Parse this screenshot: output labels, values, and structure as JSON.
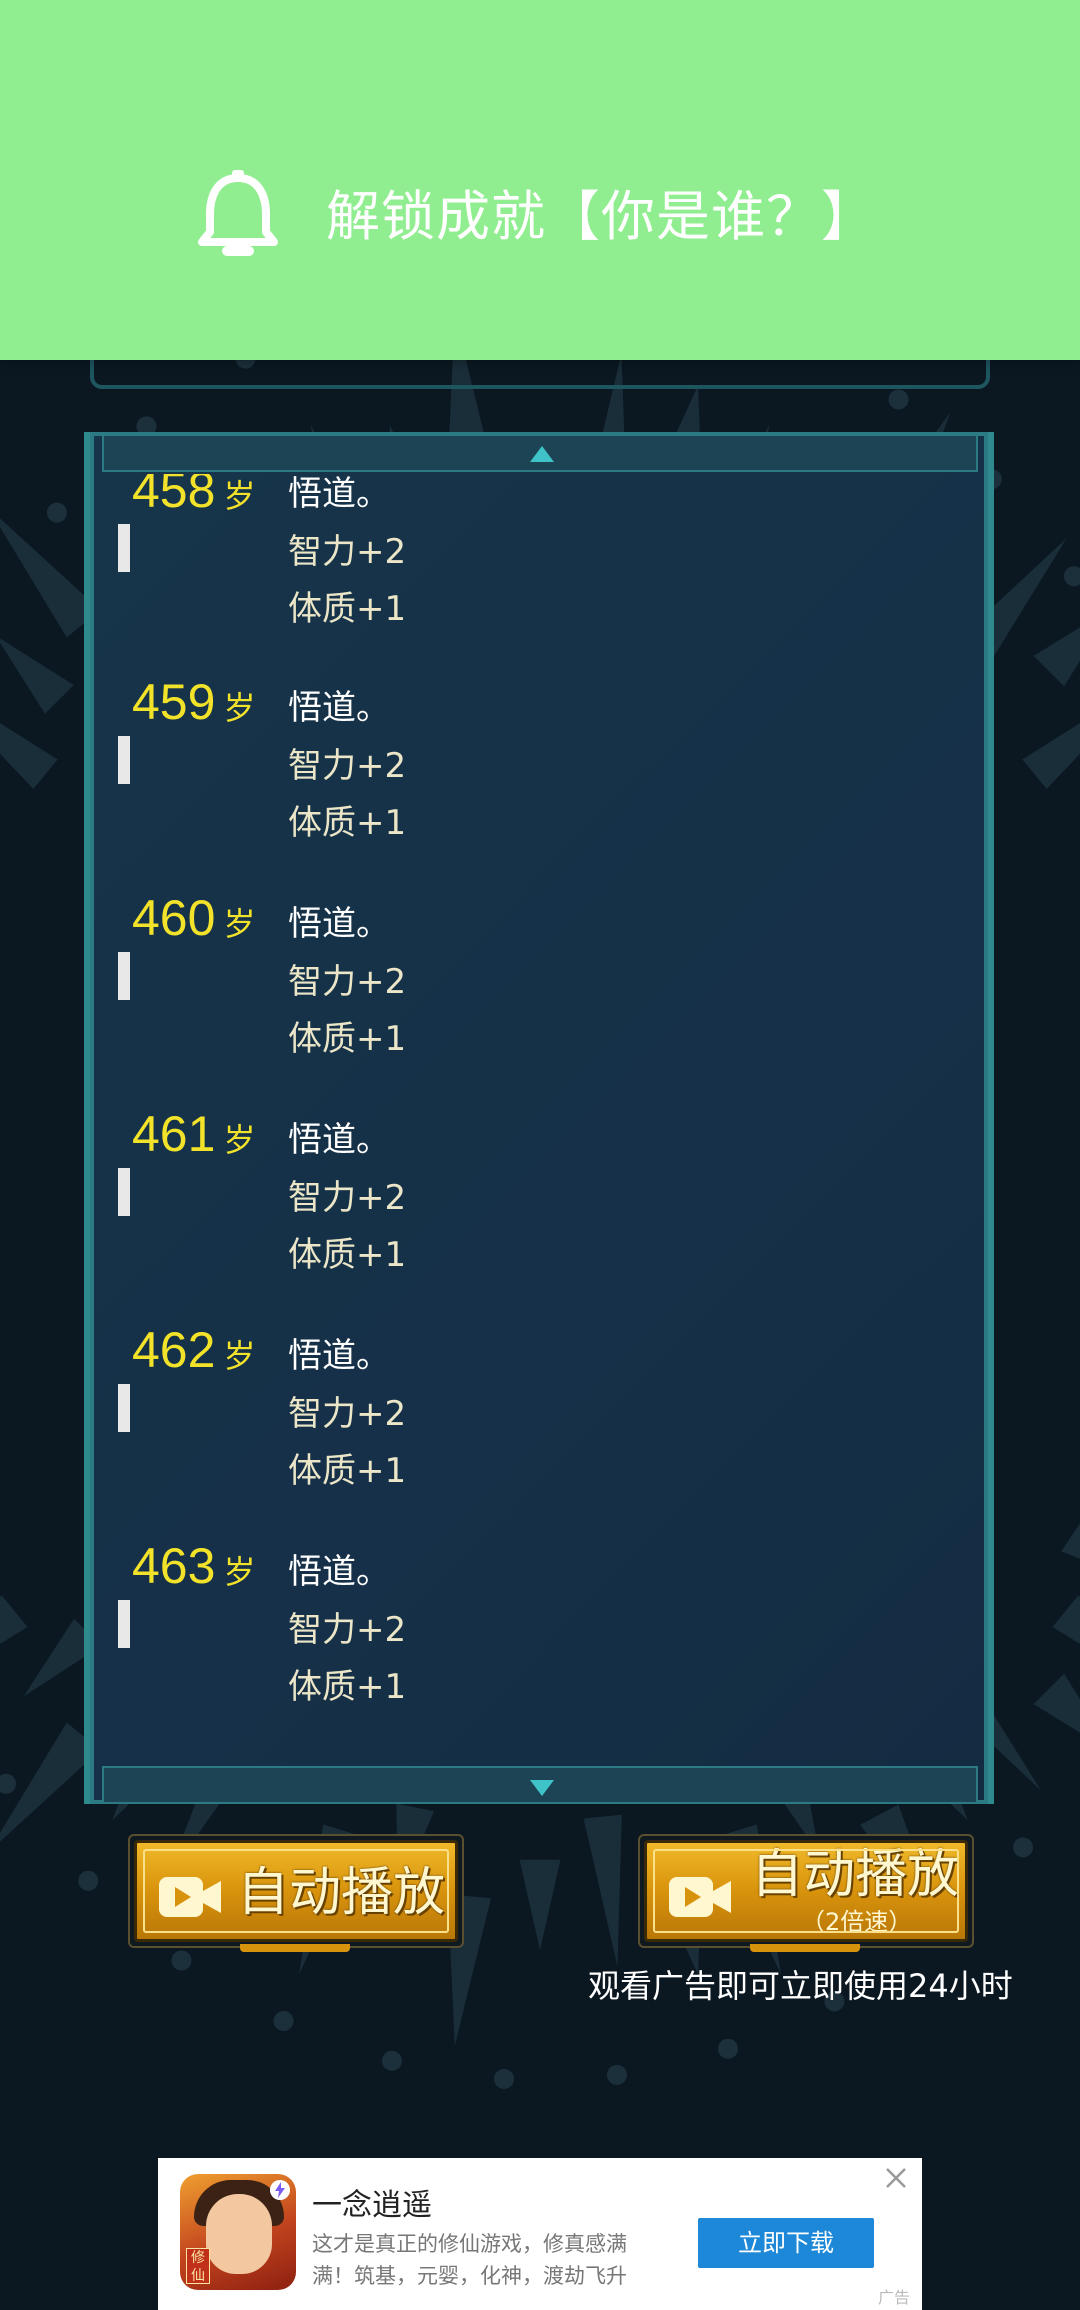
{
  "notification": {
    "icon": "bell-icon",
    "text": "解锁成就【你是谁？】"
  },
  "log": {
    "unit": "岁",
    "entries": [
      {
        "age": "458",
        "lines": [
          "悟道。",
          "智力+2",
          "体质+1"
        ]
      },
      {
        "age": "459",
        "lines": [
          "悟道。",
          "智力+2",
          "体质+1"
        ]
      },
      {
        "age": "460",
        "lines": [
          "悟道。",
          "智力+2",
          "体质+1"
        ]
      },
      {
        "age": "461",
        "lines": [
          "悟道。",
          "智力+2",
          "体质+1"
        ]
      },
      {
        "age": "462",
        "lines": [
          "悟道。",
          "智力+2",
          "体质+1"
        ]
      },
      {
        "age": "463",
        "lines": [
          "悟道。",
          "智力+2",
          "体质+1"
        ]
      }
    ]
  },
  "buttons": {
    "autoplay": {
      "label": "自动播放",
      "icon": "video-camera-icon"
    },
    "autoplay_fast": {
      "label": "自动播放",
      "sub": "（2倍速）",
      "icon": "video-camera-icon"
    }
  },
  "note": "观看广告即可立即使用24小时",
  "ad": {
    "title": "一念逍遥",
    "description": "这才是真正的修仙游戏，修真感满满！筑基，元婴，化神，渡劫飞升",
    "download_label": "立即下载",
    "icon_tag": "修仙",
    "ad_label": "广告"
  },
  "colors": {
    "notification_bg": "#90ee90",
    "age_text": "#f2e32a",
    "panel_border": "#2c7b84",
    "button_gold": "#e0a418",
    "download_blue": "#1e88d8"
  }
}
